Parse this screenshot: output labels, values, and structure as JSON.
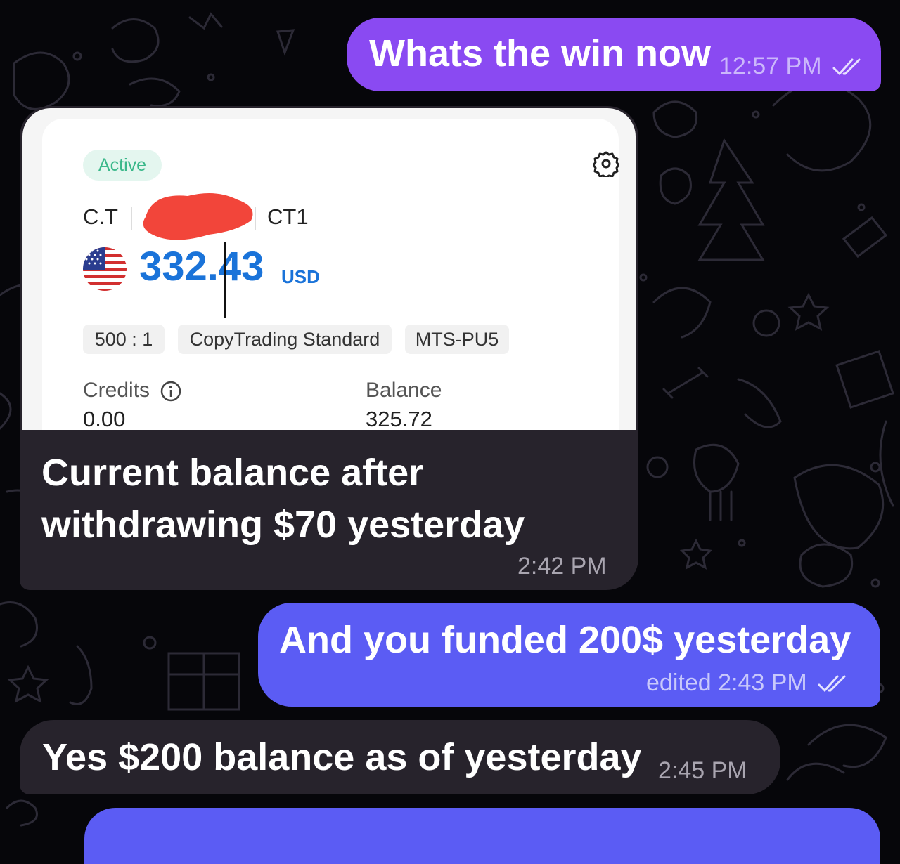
{
  "chat": {
    "messages": [
      {
        "text": "Whats the win now",
        "time": "12:57 PM",
        "status": "read"
      },
      {
        "caption": [
          "Current balance after",
          "withdrawing $70 yesterday"
        ],
        "time": "2:42 PM",
        "card": {
          "status_badge": "Active",
          "account_prefix": "C.T",
          "account_suffix": "CT1",
          "amount": "332.43",
          "currency": "USD",
          "leverage": "500 : 1",
          "account_type": "CopyTrading Standard",
          "server": "MTS-PU5",
          "credits_label": "Credits",
          "credits_value": "0.00",
          "balance_label": "Balance",
          "balance_value": "325.72"
        }
      },
      {
        "text": "And you funded 200$ yesterday",
        "meta": "edited 2:43 PM",
        "status": "read"
      },
      {
        "text": "Yes $200 balance as of yesterday",
        "time": "2:45 PM"
      }
    ]
  },
  "colors": {
    "background": "#06060a",
    "outgoing_purple": "#8a4af2",
    "outgoing_blue": "#5b5cf4",
    "incoming": "#27232c",
    "amount_blue": "#1a73d9",
    "active_green": "#3ab88a"
  },
  "icons": [
    "double-check-icon",
    "gear-icon",
    "us-flag-icon",
    "info-icon",
    "redaction-mark"
  ]
}
